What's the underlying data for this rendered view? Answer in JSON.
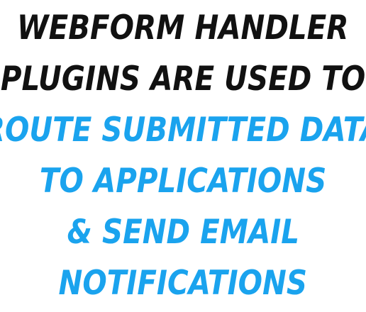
{
  "headline": {
    "lines": [
      "WEBFORM HANDLER",
      "PLUGINS ARE USED TO",
      "ROUTE SUBMITTED DATA",
      "TO APPLICATIONS",
      "& SEND EMAIL",
      "NOTIFICATIONS"
    ]
  },
  "colors": {
    "dark_text": "#111111",
    "accent_text": "#1aa3ee",
    "background": "#ffffff"
  }
}
